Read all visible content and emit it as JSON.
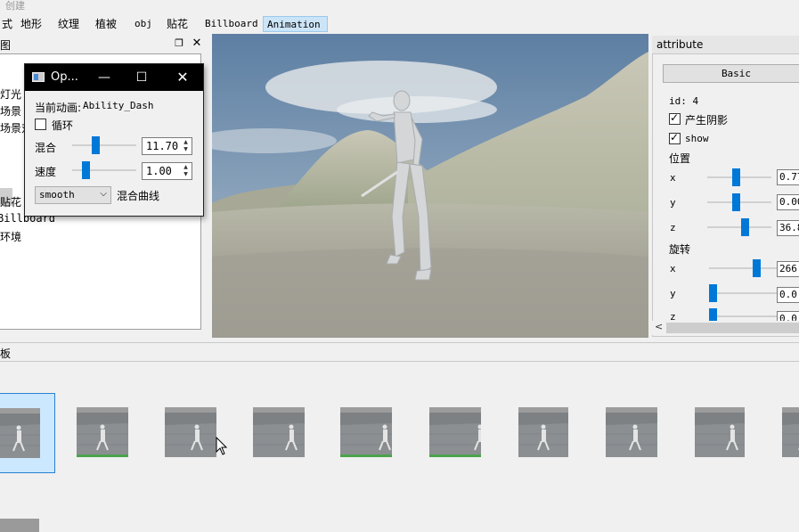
{
  "window": {
    "title_partial": "创建"
  },
  "menubar": {
    "items": [
      {
        "label": "式"
      },
      {
        "label": "地形"
      },
      {
        "label": "纹理"
      },
      {
        "label": "植被"
      },
      {
        "label": "obj"
      },
      {
        "label": "贴花"
      },
      {
        "label": "Billboard"
      },
      {
        "label": "Animation",
        "active": true
      }
    ]
  },
  "left_dock": {
    "title": "图",
    "float_icon": "restore-icon",
    "close_icon": "close-icon",
    "tree_items": [
      "灯光",
      "场景",
      "场景对",
      "贴花",
      "Billboard",
      "环境"
    ]
  },
  "dialog": {
    "title": "Op...",
    "current_animation_label": "当前动画:",
    "current_animation_value": "Ability_Dash",
    "loop_label": "循环",
    "loop_checked": false,
    "blend_label": "混合",
    "blend_value": "11.70",
    "blend_slider_fraction": 0.35,
    "speed_label": "速度",
    "speed_value": "1.00",
    "speed_slider_fraction": 0.18,
    "curve_combo_value": "smooth",
    "curve_label": "混合曲线"
  },
  "attribute": {
    "title": "attribute",
    "basic_button": "Basic",
    "id_text": "id: 4",
    "cast_shadow_label": "产生阴影",
    "cast_shadow_checked": true,
    "show_label": "show",
    "show_checked": true,
    "position_label": "位置",
    "position": [
      {
        "axis": "x",
        "value": "0.77",
        "fraction": 0.45
      },
      {
        "axis": "y",
        "value": "0.00",
        "fraction": 0.45
      },
      {
        "axis": "z",
        "value": "36.8",
        "fraction": 0.6
      }
    ],
    "rotation_label": "旋转",
    "rotation": [
      {
        "axis": "x",
        "value": "266",
        "fraction": 0.73
      },
      {
        "axis": "y",
        "value": "0.0",
        "fraction": 0.0
      },
      {
        "axis": "z",
        "value": "0.0",
        "fraction": 0.0
      }
    ]
  },
  "bottom_panel": {
    "title": "板",
    "thumbnail_count": 10,
    "selected_index": 0
  },
  "colors": {
    "accent": "#0078d7",
    "menu_active_bg": "#cce4f7",
    "selection_bg": "#cce8ff",
    "dialog_titlebar": "#000000"
  }
}
